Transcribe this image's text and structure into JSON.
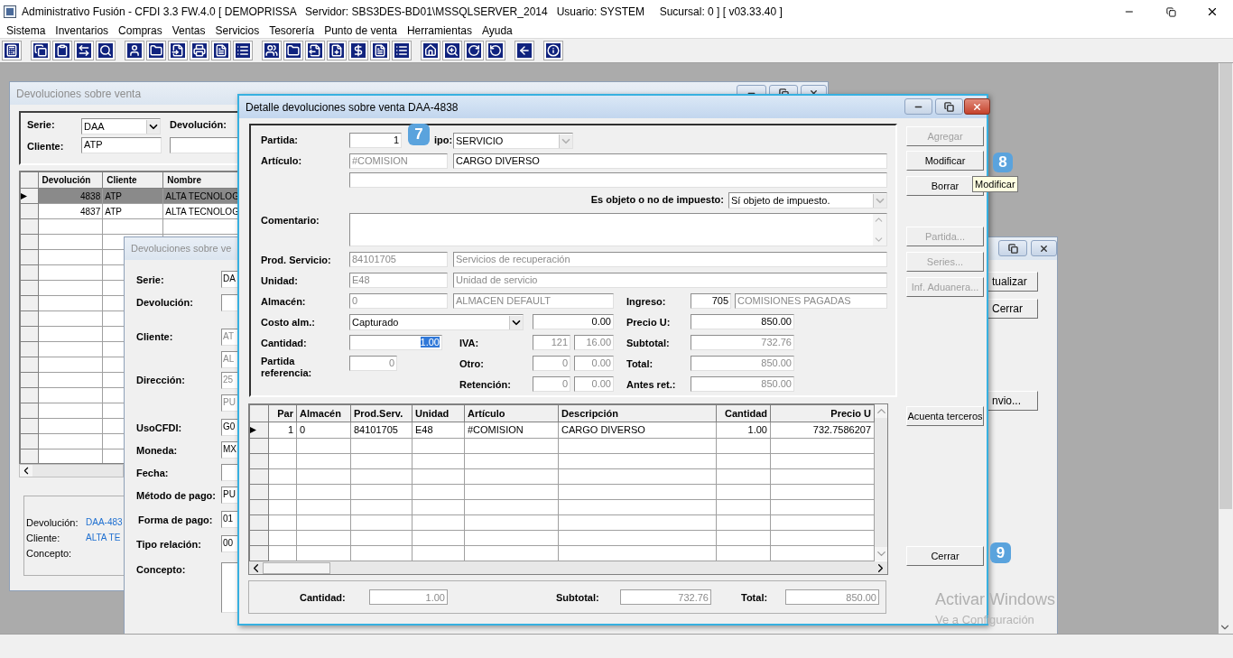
{
  "app": {
    "title": "Administrativo Fusión - CFDI 3.3 FW.4.0 [ DEMOPRISSA   Servidor: SBS3DES-BD01\\MSSQLSERVER_2014   Usuario: SYSTEM     Sucursal: 0 ] [ v03.33.40 ]"
  },
  "menu": [
    "Sistema",
    "Inventarios",
    "Compras",
    "Ventas",
    "Servicios",
    "Tesorería",
    "Punto de venta",
    "Herramientas",
    "Ayuda"
  ],
  "list_window": {
    "title": "Devoluciones sobre venta",
    "active": false,
    "filters": [
      {
        "label": "Serie:",
        "box": {
          "kind": "combo",
          "value": "DAA",
          "disabled": false
        }
      },
      {
        "label": "Devolución:"
      },
      {
        "label": "Cliente:",
        "box": {
          "kind": "text",
          "value": "ATP",
          "disabled": false
        }
      }
    ],
    "table": {
      "columns": [
        "Devolución",
        "Cliente",
        "Nombre"
      ],
      "rows": [
        {
          "selected": true,
          "cells": [
            "4838",
            "ATP",
            "ALTA TECNOLOG"
          ]
        },
        {
          "selected": false,
          "cells": [
            "4837",
            "ATP",
            "ALTA TECNOLOG"
          ]
        }
      ]
    },
    "info": [
      {
        "label": "Devolución:",
        "value": "DAA-483"
      },
      {
        "label": "Cliente:",
        "value": "ALTA TE"
      },
      {
        "label": "Concepto:"
      }
    ]
  },
  "form_window": {
    "title": "Devoluciones sobre ve",
    "active": false,
    "fields": [
      {
        "label": "Serie:",
        "boxes": [
          {
            "kind": "text",
            "value": "DA",
            "disabled": false
          }
        ]
      },
      {
        "label": "Devolución:",
        "boxes": [
          {
            "kind": "text"
          }
        ]
      },
      {
        "label": "Cliente:",
        "boxes": [
          {
            "kind": "text",
            "value": "AT",
            "disabled": true
          },
          {
            "kind": "text",
            "value": "AL",
            "disabled": true
          }
        ]
      },
      {
        "label": "Dirección:",
        "boxes": [
          {
            "kind": "text",
            "value": "25",
            "disabled": true
          },
          {
            "kind": "text",
            "value": "PU",
            "disabled": true
          }
        ]
      },
      {
        "label": "UsoCFDI:",
        "boxes": [
          {
            "kind": "text",
            "value": "G0",
            "disabled": false
          }
        ]
      },
      {
        "label": "Moneda:",
        "boxes": [
          {
            "kind": "text",
            "value": "MX",
            "disabled": false
          }
        ]
      },
      {
        "label": "Fecha:",
        "boxes": [
          {
            "kind": "text"
          }
        ]
      },
      {
        "label": "Método de pago:",
        "boxes": [
          {
            "kind": "text",
            "value": "PU",
            "disabled": false
          }
        ]
      },
      {
        "label": "Forma de pago:",
        "boxes": [
          {
            "kind": "text",
            "value": "01",
            "disabled": false
          }
        ]
      },
      {
        "label": "Tipo relación:",
        "boxes": [
          {
            "kind": "text",
            "value": "00",
            "disabled": false
          }
        ]
      },
      {
        "label": "Concepto:",
        "boxes": [
          {
            "kind": "plain"
          }
        ]
      }
    ],
    "buttons": [
      "tualizar",
      "Cerrar",
      "nvio..."
    ]
  },
  "detail": {
    "title": "Detalle devoluciones sobre venta DAA-4838",
    "active": true,
    "fields": [
      {
        "label": "Partida:",
        "boxes": [
          {
            "kind": "text",
            "value": "1",
            "disabled": false
          }
        ]
      },
      {
        "label": "ipo:",
        "boxes": [
          {
            "kind": "combo",
            "value": "SERVICIO",
            "disabled": true
          }
        ]
      },
      {
        "label": "Artículo:",
        "boxes": [
          {
            "kind": "text",
            "value": "#COMISION",
            "disabled": true
          },
          {
            "kind": "text",
            "value": "CARGO DIVERSO",
            "disabled": false
          }
        ]
      },
      {
        "boxes": [
          {
            "kind": "text"
          }
        ]
      },
      {
        "label": "Es objeto o no de impuesto:",
        "boxes": [
          {
            "kind": "combo",
            "value": "Sí objeto de impuesto.",
            "disabled": true
          }
        ]
      },
      {
        "label": "Comentario:",
        "boxes": [
          {
            "kind": "area"
          }
        ]
      },
      {
        "label": "Prod. Servicio:",
        "boxes": [
          {
            "kind": "text",
            "value": "84101705",
            "disabled": true
          },
          {
            "kind": "text",
            "value": "Servicios de recuperación",
            "disabled": true
          }
        ]
      },
      {
        "label": "Unidad:",
        "boxes": [
          {
            "kind": "text",
            "value": "E48",
            "disabled": true
          },
          {
            "kind": "text",
            "value": "Unidad de servicio",
            "disabled": true
          }
        ]
      },
      {
        "label": "Almacén:",
        "boxes": [
          {
            "kind": "text",
            "value": "0",
            "disabled": true
          },
          {
            "kind": "text",
            "value": "ALMACEN DEFAULT",
            "disabled": true
          }
        ]
      },
      {
        "label": "Ingreso:",
        "boxes": [
          {
            "kind": "text",
            "value": "705",
            "disabled": false
          },
          {
            "kind": "text",
            "value": "COMISIONES PAGADAS",
            "disabled": true
          }
        ]
      },
      {
        "label": "Costo alm.:",
        "boxes": [
          {
            "kind": "combo",
            "value": "Capturado",
            "disabled": false
          },
          {
            "kind": "text",
            "value": "0.00",
            "disabled": false
          }
        ]
      },
      {
        "label": "Precio U:",
        "boxes": [
          {
            "kind": "text",
            "value": "850.00",
            "disabled": false
          }
        ]
      },
      {
        "label": "Cantidad:",
        "boxes": [
          {
            "kind": "text",
            "value": "1.00",
            "disabled": false,
            "selected": true
          }
        ]
      },
      {
        "label": "IVA:",
        "boxes": [
          {
            "kind": "text",
            "value": "121",
            "disabled": true
          },
          {
            "kind": "text",
            "value": "16.00",
            "disabled": true
          }
        ]
      },
      {
        "label": "Subtotal:",
        "boxes": [
          {
            "kind": "text",
            "value": "732.76",
            "disabled": true
          }
        ]
      },
      {
        "label": "Partida referencia:",
        "boxes": [
          {
            "kind": "text",
            "value": "0",
            "disabled": true
          }
        ]
      },
      {
        "label": "Otro:",
        "boxes": [
          {
            "kind": "text",
            "value": "0",
            "disabled": true
          },
          {
            "kind": "text",
            "value": "0.00",
            "disabled": true
          }
        ]
      },
      {
        "label": "Total:",
        "boxes": [
          {
            "kind": "text",
            "value": "850.00",
            "disabled": true
          }
        ]
      },
      {
        "label": "Retención:",
        "boxes": [
          {
            "kind": "text",
            "value": "0",
            "disabled": true
          },
          {
            "kind": "text",
            "value": "0.00",
            "disabled": true
          }
        ]
      },
      {
        "label": "Antes ret.:",
        "boxes": [
          {
            "kind": "text",
            "value": "850.00",
            "disabled": true
          }
        ]
      }
    ],
    "buttons": [
      {
        "label": "Agregar",
        "disabled": true
      },
      {
        "label": "Modificar",
        "disabled": false
      },
      {
        "label": "Borrar",
        "disabled": false
      },
      {
        "label": "Partida...",
        "disabled": true
      },
      {
        "label": "Series...",
        "disabled": true
      },
      {
        "label": "Inf. Aduanera...",
        "disabled": true
      },
      {
        "label": "Acuenta terceros",
        "disabled": false
      },
      {
        "label": "Cerrar",
        "disabled": false
      }
    ],
    "grid": {
      "columns": [
        "Par",
        "Almacén",
        "Prod.Serv.",
        "Unidad",
        "Artículo",
        "Descripción",
        "Cantidad",
        "Precio U"
      ],
      "rows": [
        {
          "selected": true,
          "cells": [
            "1",
            "0",
            "84101705",
            "E48",
            "#COMISION",
            "CARGO DIVERSO",
            "1.00",
            "732.7586207"
          ]
        }
      ]
    },
    "totals": [
      {
        "label": "Cantidad:",
        "value": "1.00"
      },
      {
        "label": "Subtotal:",
        "value": "732.76"
      },
      {
        "label": "Total:",
        "value": "850.00"
      }
    ]
  },
  "callouts": [
    "7",
    "8",
    "9"
  ],
  "tooltip": "Modificar",
  "activation_notice": [
    "Activar Windows",
    "Ve a Configuración"
  ]
}
